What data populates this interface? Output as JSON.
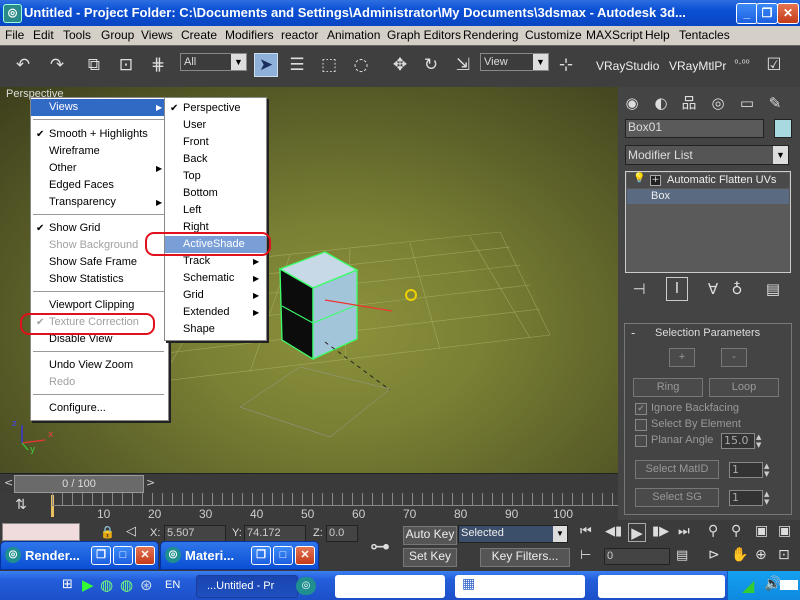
{
  "window": {
    "title": "Untitled      - Project Folder: C:\\Documents and Settings\\Administrator\\My Documents\\3dsmax      - Autodesk 3d...",
    "controls": [
      "_",
      "❐",
      "✕"
    ]
  },
  "menubar": [
    "File",
    "Edit",
    "Tools",
    "Group",
    "Views",
    "Create",
    "Modifiers",
    "reactor",
    "Animation",
    "Graph Editors",
    "Rendering",
    "Customize",
    "MAXScript",
    "Help",
    "Tentacles"
  ],
  "toolbar": {
    "selection_filter": "All",
    "ref_coord": "View",
    "vray_studio": "VRayStudio",
    "vray_mtl": "VRayMtlPr"
  },
  "viewport": {
    "label": "Perspective",
    "context_menu": [
      {
        "label": "Views",
        "submenu": true,
        "highlighted": true
      },
      {
        "separator": true
      },
      {
        "label": "Smooth + Highlights",
        "checked": true
      },
      {
        "label": "Wireframe"
      },
      {
        "label": "Other",
        "submenu": true
      },
      {
        "label": "Edged Faces"
      },
      {
        "label": "Transparency",
        "submenu": true
      },
      {
        "separator": true
      },
      {
        "label": "Show Grid",
        "checked": true
      },
      {
        "label": "Show Background",
        "disabled": true
      },
      {
        "label": "Show Safe Frame"
      },
      {
        "label": "Show Statistics"
      },
      {
        "separator": true
      },
      {
        "label": "Viewport Clipping"
      },
      {
        "label": "Texture Correction",
        "checked": true,
        "disabled": true
      },
      {
        "label": "Disable View"
      },
      {
        "separator": true
      },
      {
        "label": "Undo View Zoom"
      },
      {
        "label": "Redo",
        "disabled": true
      },
      {
        "separator": true
      },
      {
        "label": "Configure..."
      }
    ],
    "views_submenu": [
      {
        "label": "Perspective",
        "checked": true
      },
      {
        "label": "User"
      },
      {
        "label": "Front"
      },
      {
        "label": "Back"
      },
      {
        "label": "Top"
      },
      {
        "label": "Bottom"
      },
      {
        "label": "Left"
      },
      {
        "label": "Right"
      },
      {
        "label": "ActiveShade",
        "highlighted": true
      },
      {
        "label": "Track",
        "submenu": true
      },
      {
        "label": "Schematic",
        "submenu": true
      },
      {
        "label": "Grid",
        "submenu": true
      },
      {
        "label": "Extended",
        "submenu": true
      },
      {
        "label": "Shape"
      }
    ],
    "axis": {
      "x": "x",
      "y": "y",
      "z": "z"
    }
  },
  "command_panel": {
    "object_name": "Box01",
    "object_color": "#a8d8e0",
    "modifier_list": "Modifier List",
    "stack": [
      "Automatic Flatten UVs",
      "Box"
    ],
    "rollout_title": "Selection Parameters",
    "rollout_minus": "-",
    "plus": "+",
    "minus": "-",
    "ring": "Ring",
    "loop": "Loop",
    "ignore_backfacing": "Ignore Backfacing",
    "select_by_element": "Select By Element",
    "planar_angle": "Planar Angle",
    "planar_angle_value": "15.0",
    "select_matid": "Select MatID",
    "select_sg": "Select SG",
    "matid_value": "1",
    "sg_value": "1"
  },
  "timeline": {
    "frame": "0 / 100",
    "prev": "<",
    "next": ">",
    "ticks": [
      "10",
      "20",
      "30",
      "40",
      "50",
      "60",
      "70",
      "80",
      "90",
      "100"
    ]
  },
  "statusbar": {
    "x_label": "X:",
    "x_value": "5.507",
    "y_label": "Y:",
    "y_value": "74.172",
    "z_label": "Z:",
    "z_value": "0.0",
    "auto_key": "Auto Key",
    "set_key": "Set Key",
    "selected": "Selected",
    "key_filters": "Key Filters...",
    "frame_value": "0"
  },
  "floating_windows": [
    {
      "title": "Render..."
    },
    {
      "title": "Materi..."
    }
  ],
  "taskbar": {
    "lang": "EN",
    "items": [
      "...Untitled     - Pr"
    ]
  }
}
